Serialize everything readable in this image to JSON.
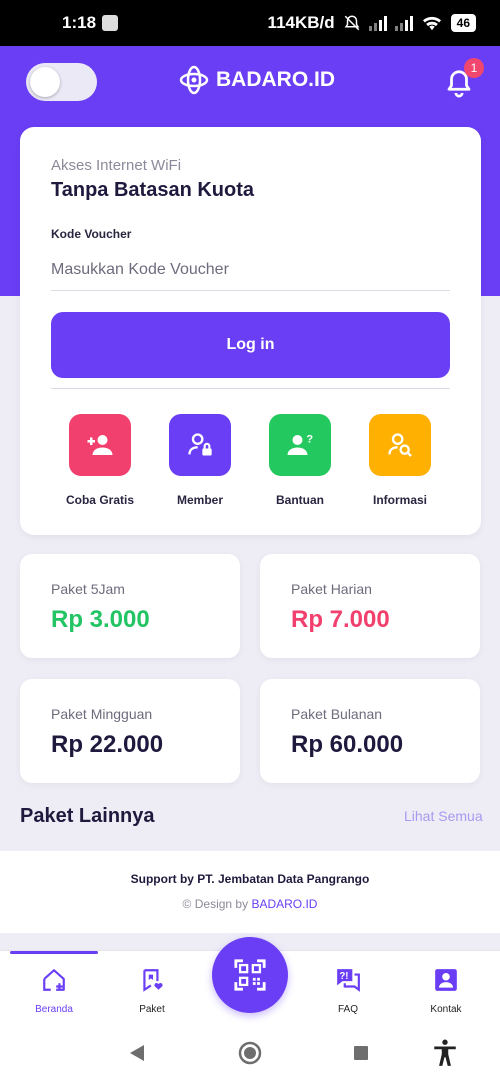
{
  "status_bar": {
    "time": "1:18",
    "net_speed": "114KB/d",
    "battery": "46"
  },
  "header": {
    "brand": "BADARO.ID",
    "notification_count": "1"
  },
  "login_card": {
    "subtitle": "Akses Internet WiFi",
    "title": "Tanpa Batasan Kuota",
    "voucher_label": "Kode Voucher",
    "voucher_placeholder": "Masukkan Kode Voucher",
    "login_label": "Log in",
    "actions": [
      {
        "label": "Coba Gratis",
        "icon": "user-plus-icon",
        "color": "#f2406e"
      },
      {
        "label": "Member",
        "icon": "user-lock-icon",
        "color": "#6a3ef5"
      },
      {
        "label": "Bantuan",
        "icon": "user-question-icon",
        "color": "#23c85f"
      },
      {
        "label": "Informasi",
        "icon": "user-search-icon",
        "color": "#ffb000"
      }
    ]
  },
  "packages": [
    {
      "name": "Paket 5Jam",
      "price": "Rp 3.000",
      "color": "#22c463"
    },
    {
      "name": "Paket Harian",
      "price": "Rp 7.000",
      "color": "#f2406e"
    },
    {
      "name": "Paket Mingguan",
      "price": "Rp 22.000",
      "color": "#1f1a3d"
    },
    {
      "name": "Paket Bulanan",
      "price": "Rp 60.000",
      "color": "#1f1a3d"
    }
  ],
  "more": {
    "title": "Paket Lainnya",
    "link": "Lihat Semua"
  },
  "footer": {
    "support": "Support by PT. Jembatan Data Pangrango",
    "design_prefix": "© Design by",
    "design_brand": "BADARO.ID"
  },
  "bottom_nav": [
    {
      "label": "Beranda",
      "icon": "home-plus-icon",
      "active": true
    },
    {
      "label": "Paket",
      "icon": "bookmark-heart-icon",
      "active": false
    },
    {
      "label": "",
      "icon": "qr-code-icon",
      "active": false
    },
    {
      "label": "FAQ",
      "icon": "faq-chat-icon",
      "active": false
    },
    {
      "label": "Kontak",
      "icon": "contact-card-icon",
      "active": false
    }
  ],
  "colors": {
    "primary": "#6a3ef5",
    "background": "#eeedf6"
  }
}
